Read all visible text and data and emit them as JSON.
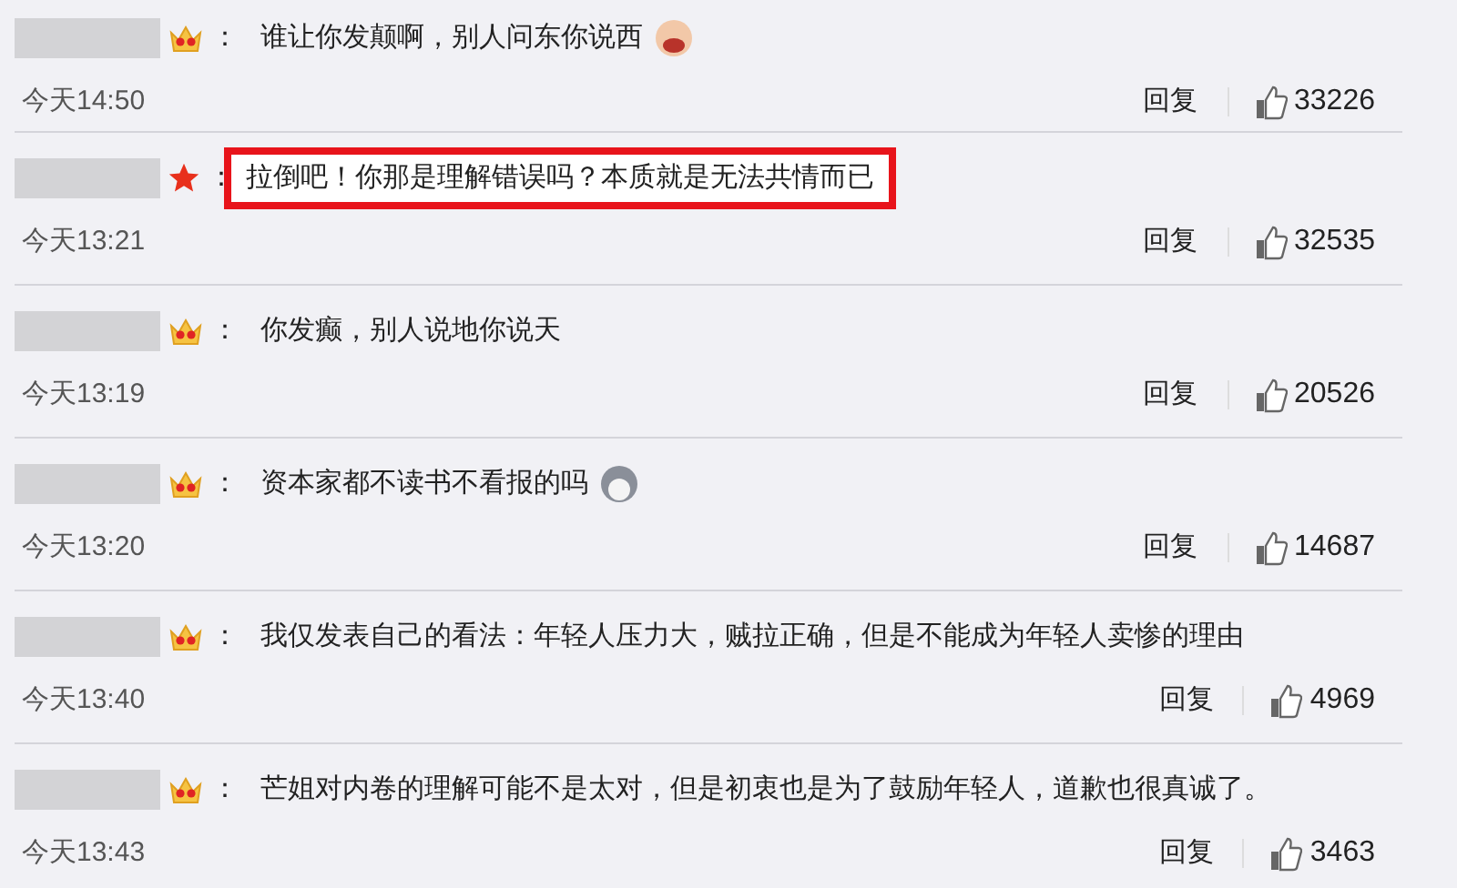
{
  "comments": [
    {
      "badge": {
        "kind": "crown"
      },
      "colon": "：",
      "text": "谁让你发颠啊，别人问东你说西",
      "emoji": {
        "kind": "baby"
      },
      "highlighted": false,
      "time": "今天14:50",
      "reply": "回复",
      "likes": "33226"
    },
    {
      "badge": {
        "kind": "star"
      },
      "colon": "：",
      "text": "拉倒吧！你那是理解错误吗？本质就是无法共情而已",
      "highlighted": true,
      "time": "今天13:21",
      "reply": "回复",
      "likes": "32535"
    },
    {
      "badge": {
        "kind": "crown"
      },
      "colon": "：",
      "text": "你发癫，别人说地你说天",
      "highlighted": false,
      "time": "今天13:19",
      "reply": "回复",
      "likes": "20526"
    },
    {
      "badge": {
        "kind": "crown"
      },
      "colon": "：",
      "text": "资本家都不读书不看报的吗",
      "emoji": {
        "kind": "dog"
      },
      "highlighted": false,
      "time": "今天13:20",
      "reply": "回复",
      "likes": "14687"
    },
    {
      "badge": {
        "kind": "crown"
      },
      "colon": "：",
      "text": "我仅发表自己的看法：年轻人压力大，贼拉正确，但是不能成为年轻人卖惨的理由",
      "highlighted": false,
      "time": "今天13:40",
      "reply": "回复",
      "likes": "4969"
    },
    {
      "badge": {
        "kind": "crown"
      },
      "colon": "：",
      "text": "芒姐对内卷的理解可能不是太对，但是初衷也是为了鼓励年轻人，道歉也很真诚了。",
      "highlighted": false,
      "time": "今天13:43",
      "reply": "回复",
      "likes": "3463"
    }
  ]
}
